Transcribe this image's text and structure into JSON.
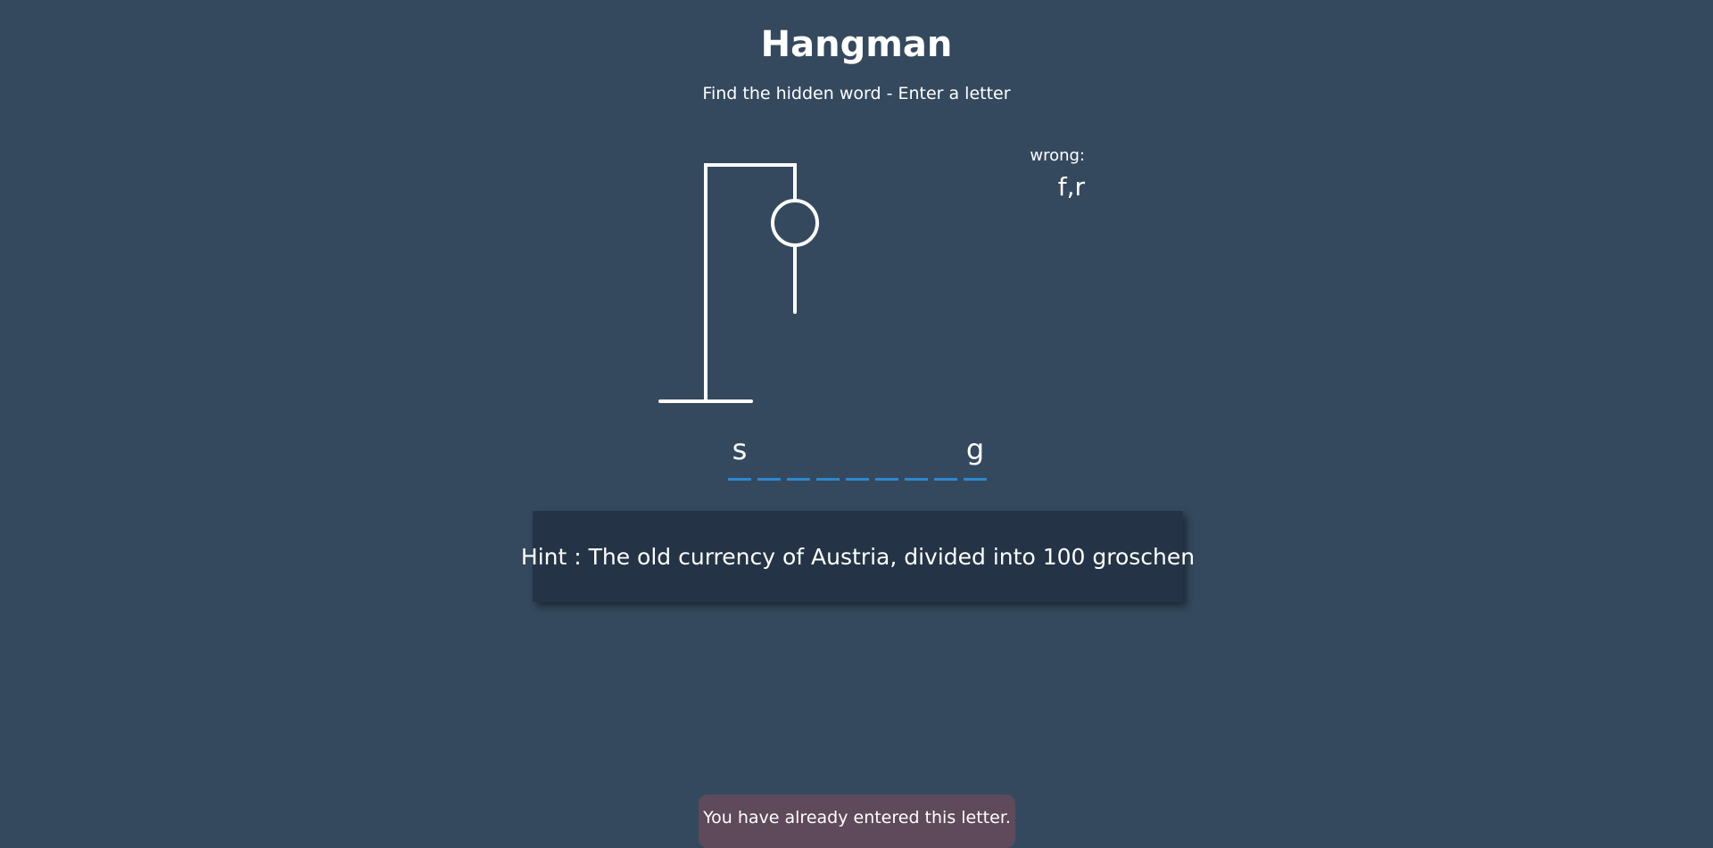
{
  "header": {
    "title": "Hangman",
    "subtitle": "Find the hidden word - Enter a letter"
  },
  "wrong": {
    "label": "wrong:",
    "letters": "f,r"
  },
  "word": {
    "slots": [
      "s",
      "",
      "",
      "",
      "",
      "",
      "",
      "",
      "g"
    ]
  },
  "hint": {
    "text": "Hint : The old currency of Austria, divided into 100 groschen"
  },
  "notification": {
    "text": "You have already entered this letter."
  },
  "colors": {
    "background": "#34495e",
    "underline": "#2d88d1",
    "hint_background": "#243446",
    "toast_background": "#5e4a5a"
  },
  "hangman": {
    "drawn_parts": [
      "base",
      "pole",
      "beam",
      "rope",
      "head",
      "body"
    ]
  }
}
